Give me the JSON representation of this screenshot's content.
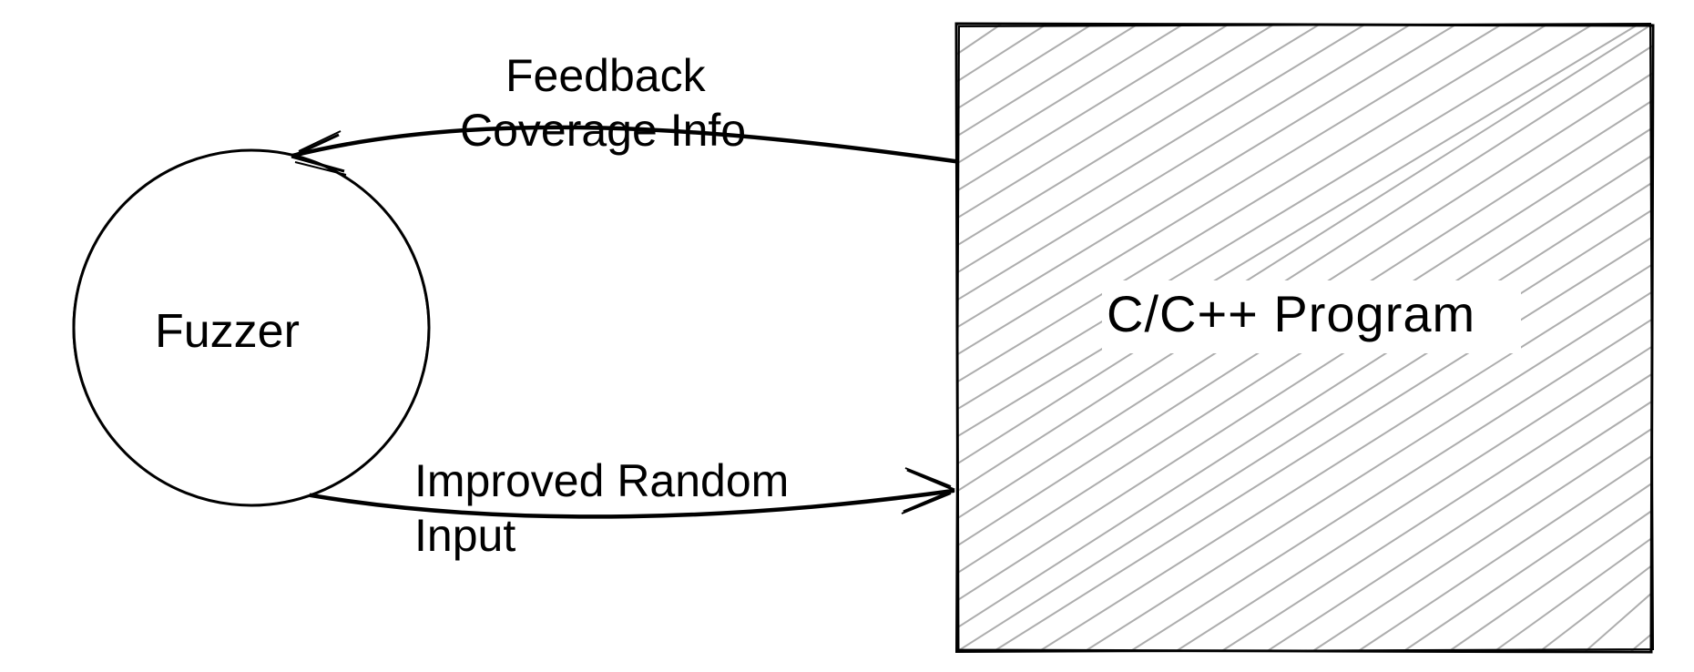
{
  "nodes": {
    "fuzzer": {
      "label": "Fuzzer"
    },
    "program": {
      "label": "C/C++ Program"
    }
  },
  "edges": {
    "feedback": {
      "line1": "Feedback",
      "line2": "Coverage Info"
    },
    "input": {
      "line1": "Improved Random",
      "line2": "Input"
    }
  }
}
